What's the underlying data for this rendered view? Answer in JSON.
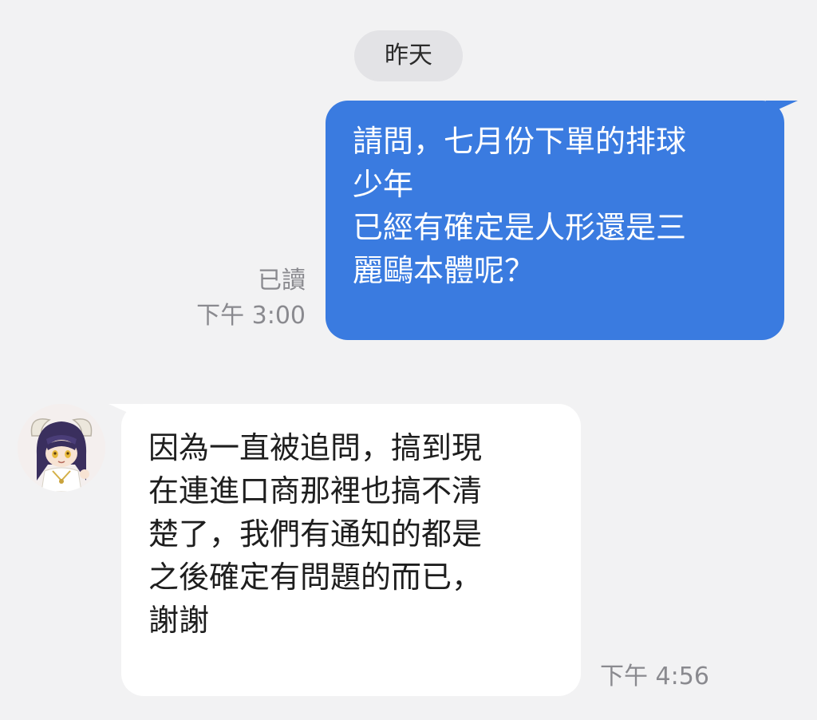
{
  "date_divider": "昨天",
  "messages": [
    {
      "direction": "outgoing",
      "text": "請問，七月份下單的排球\n少年\n已經有確定是人形還是三\n麗鷗本體呢？",
      "read_status": "已讀",
      "time": "下午 3:00"
    },
    {
      "direction": "incoming",
      "text": "因為一直被追問，搞到現\n在連進口商那裡也搞不清\n楚了，我們有通知的都是\n之後確定有問題的而已，\n謝謝",
      "time": "下午 4:56"
    }
  ],
  "colors": {
    "background": "#f2f2f3",
    "outgoing_bubble": "#3a7be0",
    "incoming_bubble": "#ffffff",
    "meta_text": "#8a8a8f"
  }
}
